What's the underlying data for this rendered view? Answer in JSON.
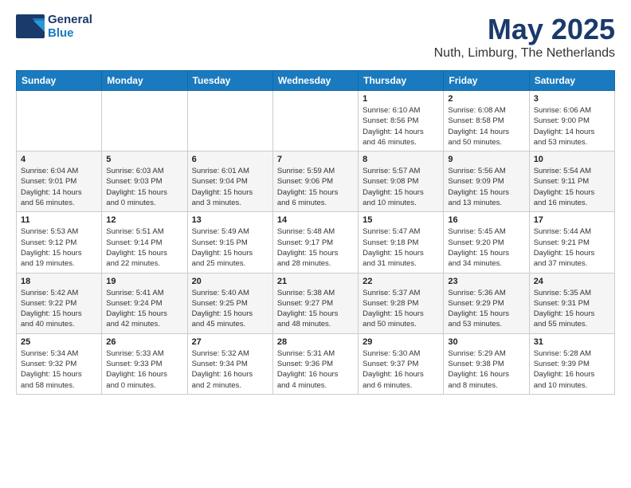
{
  "logo": {
    "line1": "General",
    "line2": "Blue"
  },
  "title": "May 2025",
  "subtitle": "Nuth, Limburg, The Netherlands",
  "days_of_week": [
    "Sunday",
    "Monday",
    "Tuesday",
    "Wednesday",
    "Thursday",
    "Friday",
    "Saturday"
  ],
  "weeks": [
    [
      {
        "day": "",
        "info": ""
      },
      {
        "day": "",
        "info": ""
      },
      {
        "day": "",
        "info": ""
      },
      {
        "day": "",
        "info": ""
      },
      {
        "day": "1",
        "info": "Sunrise: 6:10 AM\nSunset: 8:56 PM\nDaylight: 14 hours\nand 46 minutes."
      },
      {
        "day": "2",
        "info": "Sunrise: 6:08 AM\nSunset: 8:58 PM\nDaylight: 14 hours\nand 50 minutes."
      },
      {
        "day": "3",
        "info": "Sunrise: 6:06 AM\nSunset: 9:00 PM\nDaylight: 14 hours\nand 53 minutes."
      }
    ],
    [
      {
        "day": "4",
        "info": "Sunrise: 6:04 AM\nSunset: 9:01 PM\nDaylight: 14 hours\nand 56 minutes."
      },
      {
        "day": "5",
        "info": "Sunrise: 6:03 AM\nSunset: 9:03 PM\nDaylight: 15 hours\nand 0 minutes."
      },
      {
        "day": "6",
        "info": "Sunrise: 6:01 AM\nSunset: 9:04 PM\nDaylight: 15 hours\nand 3 minutes."
      },
      {
        "day": "7",
        "info": "Sunrise: 5:59 AM\nSunset: 9:06 PM\nDaylight: 15 hours\nand 6 minutes."
      },
      {
        "day": "8",
        "info": "Sunrise: 5:57 AM\nSunset: 9:08 PM\nDaylight: 15 hours\nand 10 minutes."
      },
      {
        "day": "9",
        "info": "Sunrise: 5:56 AM\nSunset: 9:09 PM\nDaylight: 15 hours\nand 13 minutes."
      },
      {
        "day": "10",
        "info": "Sunrise: 5:54 AM\nSunset: 9:11 PM\nDaylight: 15 hours\nand 16 minutes."
      }
    ],
    [
      {
        "day": "11",
        "info": "Sunrise: 5:53 AM\nSunset: 9:12 PM\nDaylight: 15 hours\nand 19 minutes."
      },
      {
        "day": "12",
        "info": "Sunrise: 5:51 AM\nSunset: 9:14 PM\nDaylight: 15 hours\nand 22 minutes."
      },
      {
        "day": "13",
        "info": "Sunrise: 5:49 AM\nSunset: 9:15 PM\nDaylight: 15 hours\nand 25 minutes."
      },
      {
        "day": "14",
        "info": "Sunrise: 5:48 AM\nSunset: 9:17 PM\nDaylight: 15 hours\nand 28 minutes."
      },
      {
        "day": "15",
        "info": "Sunrise: 5:47 AM\nSunset: 9:18 PM\nDaylight: 15 hours\nand 31 minutes."
      },
      {
        "day": "16",
        "info": "Sunrise: 5:45 AM\nSunset: 9:20 PM\nDaylight: 15 hours\nand 34 minutes."
      },
      {
        "day": "17",
        "info": "Sunrise: 5:44 AM\nSunset: 9:21 PM\nDaylight: 15 hours\nand 37 minutes."
      }
    ],
    [
      {
        "day": "18",
        "info": "Sunrise: 5:42 AM\nSunset: 9:22 PM\nDaylight: 15 hours\nand 40 minutes."
      },
      {
        "day": "19",
        "info": "Sunrise: 5:41 AM\nSunset: 9:24 PM\nDaylight: 15 hours\nand 42 minutes."
      },
      {
        "day": "20",
        "info": "Sunrise: 5:40 AM\nSunset: 9:25 PM\nDaylight: 15 hours\nand 45 minutes."
      },
      {
        "day": "21",
        "info": "Sunrise: 5:38 AM\nSunset: 9:27 PM\nDaylight: 15 hours\nand 48 minutes."
      },
      {
        "day": "22",
        "info": "Sunrise: 5:37 AM\nSunset: 9:28 PM\nDaylight: 15 hours\nand 50 minutes."
      },
      {
        "day": "23",
        "info": "Sunrise: 5:36 AM\nSunset: 9:29 PM\nDaylight: 15 hours\nand 53 minutes."
      },
      {
        "day": "24",
        "info": "Sunrise: 5:35 AM\nSunset: 9:31 PM\nDaylight: 15 hours\nand 55 minutes."
      }
    ],
    [
      {
        "day": "25",
        "info": "Sunrise: 5:34 AM\nSunset: 9:32 PM\nDaylight: 15 hours\nand 58 minutes."
      },
      {
        "day": "26",
        "info": "Sunrise: 5:33 AM\nSunset: 9:33 PM\nDaylight: 16 hours\nand 0 minutes."
      },
      {
        "day": "27",
        "info": "Sunrise: 5:32 AM\nSunset: 9:34 PM\nDaylight: 16 hours\nand 2 minutes."
      },
      {
        "day": "28",
        "info": "Sunrise: 5:31 AM\nSunset: 9:36 PM\nDaylight: 16 hours\nand 4 minutes."
      },
      {
        "day": "29",
        "info": "Sunrise: 5:30 AM\nSunset: 9:37 PM\nDaylight: 16 hours\nand 6 minutes."
      },
      {
        "day": "30",
        "info": "Sunrise: 5:29 AM\nSunset: 9:38 PM\nDaylight: 16 hours\nand 8 minutes."
      },
      {
        "day": "31",
        "info": "Sunrise: 5:28 AM\nSunset: 9:39 PM\nDaylight: 16 hours\nand 10 minutes."
      }
    ]
  ]
}
